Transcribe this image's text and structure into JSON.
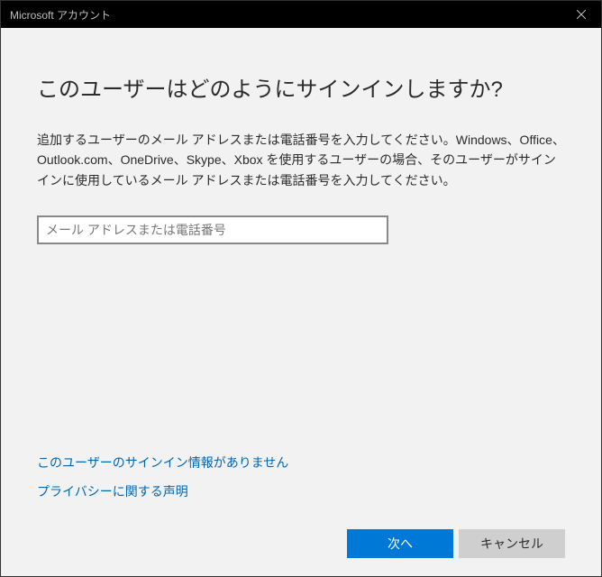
{
  "titlebar": {
    "title": "Microsoft アカウント"
  },
  "main": {
    "heading": "このユーザーはどのようにサインインしますか?",
    "description": "追加するユーザーのメール アドレスまたは電話番号を入力してください。Windows、Office、Outlook.com、OneDrive、Skype、Xbox を使用するユーザーの場合、そのユーザーがサインインに使用しているメール アドレスまたは電話番号を入力してください。",
    "email_placeholder": "メール アドレスまたは電話番号",
    "email_value": ""
  },
  "links": {
    "no_signin_info": "このユーザーのサインイン情報がありません",
    "privacy": "プライバシーに関する声明"
  },
  "buttons": {
    "next": "次へ",
    "cancel": "キャンセル"
  }
}
